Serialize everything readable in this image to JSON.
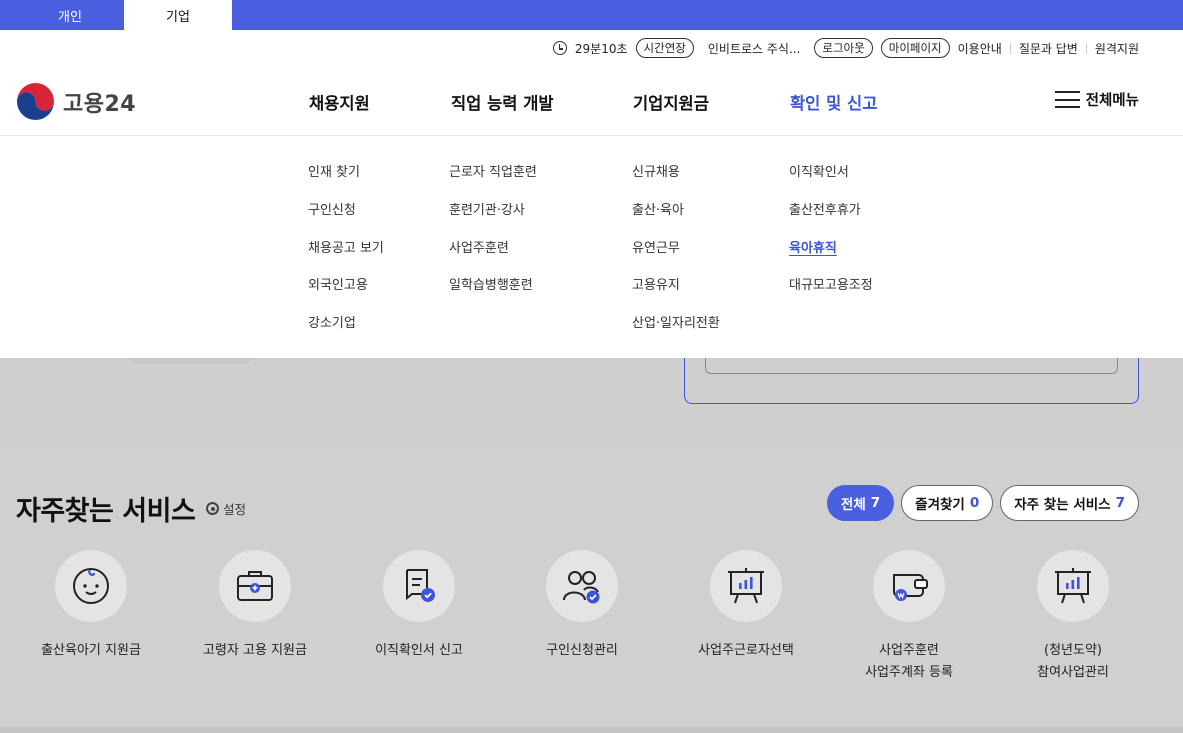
{
  "top_tabs": [
    "개인",
    "기업"
  ],
  "util": {
    "timer": "29분10초",
    "extend": "시간연장",
    "company": "인비트로스 주식...",
    "logout": "로그아웃",
    "mypage": "마이페이지",
    "guide": "이용안내",
    "qna": "질문과 답변",
    "remote": "원격지원"
  },
  "logo": {
    "text": "고용24"
  },
  "gnb": [
    "채용지원",
    "직업 능력 개발",
    "기업지원금",
    "확인 및 신고"
  ],
  "all_menu": "전체메뉴",
  "mega": {
    "col1": [
      "인재 찾기",
      "구인신청",
      "채용공고 보기",
      "외국인고용",
      "강소기업"
    ],
    "col2": [
      "근로자 직업훈련",
      "훈련기관·강사",
      "사업주훈련",
      "일학습병행훈련"
    ],
    "col3": [
      "신규채용",
      "출산·육아",
      "유연근무",
      "고용유지",
      "산업·일자리전환"
    ],
    "col4": [
      "이직확인서",
      "출산전후휴가",
      "육아휴직",
      "대규모고용조정"
    ]
  },
  "services": {
    "title": "자주찾는 서비스",
    "setting": "설정",
    "filters": [
      {
        "label": "전체",
        "count": "7"
      },
      {
        "label": "즐겨찾기",
        "count": "0"
      },
      {
        "label": "자주 찾는 서비스",
        "count": "7"
      }
    ],
    "items": [
      {
        "label": "출산육아기 지원금",
        "icon": "baby-icon"
      },
      {
        "label": "고령자 고용 지원금",
        "icon": "briefcase-icon"
      },
      {
        "label": "이직확인서 신고",
        "icon": "document-check-icon"
      },
      {
        "label": "구인신청관리",
        "icon": "people-check-icon"
      },
      {
        "label": "사업주근로자선택",
        "icon": "chart-board-icon"
      },
      {
        "label": "사업주훈련\n사업주계좌 등록",
        "icon": "wallet-icon"
      },
      {
        "label": "(청년도약)\n참여사업관리",
        "icon": "chart-board-icon"
      }
    ]
  },
  "colors": {
    "accent": "#4a5fe0",
    "active_text": "#3d54d6"
  }
}
